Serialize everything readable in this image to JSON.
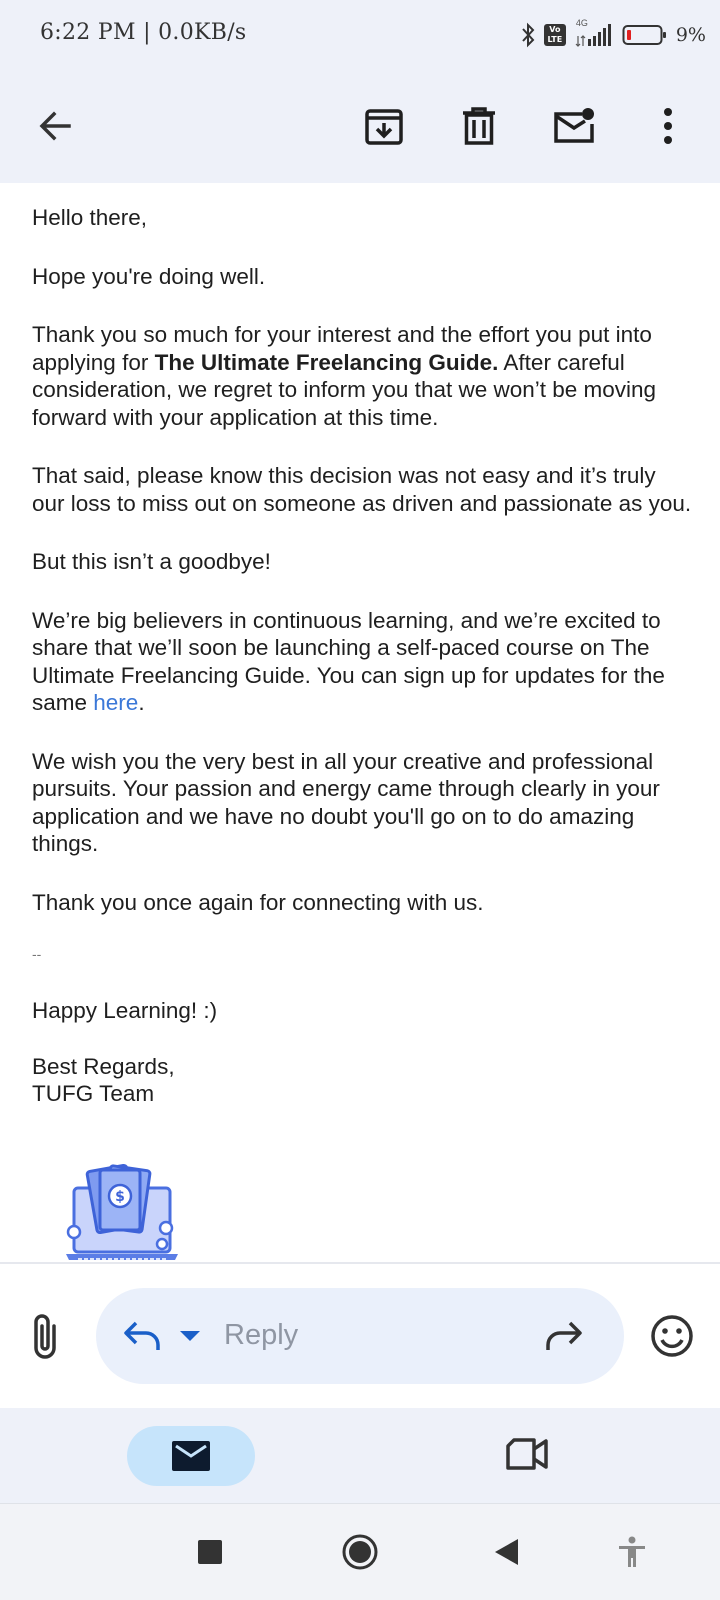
{
  "status_bar": {
    "time_speed": "6:22 PM | 0.0KB/s",
    "network": "4G",
    "lte": "Vo LTE",
    "battery": "9%"
  },
  "app_bar": {
    "icons": [
      "back-arrow-icon",
      "archive-icon",
      "trash-icon",
      "mark-unread-icon",
      "more-vert-icon"
    ]
  },
  "email": {
    "greeting": "Hello there,",
    "p1": "Hope you're doing well.",
    "p2_pre": "Thank you so much for your interest and the effort you put into applying for ",
    "p2_bold": "The Ultimate Freelancing Guide.",
    "p2_post": " After careful consideration, we regret to inform you that we won’t be moving forward with your application at this time.",
    "p3": "That said, please know this decision was not easy and it’s truly our loss to miss out on someone as driven and passionate as you.",
    "p4": "But this isn’t a goodbye!",
    "p5_pre": "We’re big believers in continuous learning, and we’re excited to share that we’ll soon be launching a self-paced course on The Ultimate Freelancing Guide. You can sign up for updates for the same ",
    "p5_link": "here",
    "p5_post": ".",
    "p6": "We wish you the very best in all your creative and professional pursuits. Your passion and energy came through clearly in your application and we have no doubt you'll go on to do amazing things.",
    "p7": "Thank you once again for connecting with us.",
    "sig_separator": "--",
    "sig_line1": "Happy Learning! :)",
    "sig_line2": "Best Regards,",
    "sig_line3": "TUFG Team",
    "logo_icon": "laptop-money-logo"
  },
  "reply_bar": {
    "placeholder": "Reply",
    "icons": [
      "attachment-icon",
      "reply-icon",
      "reply-options-dropdown-icon",
      "forward-icon",
      "emoji-icon"
    ]
  },
  "bottom_nav": {
    "items": [
      "mail-icon",
      "video-meet-icon"
    ],
    "active": "mail-icon",
    "active_color": "#c6e4fb"
  },
  "system_nav": {
    "icons": [
      "recents-square-icon",
      "home-circle-icon",
      "back-triangle-icon",
      "accessibility-icon"
    ]
  },
  "colors": {
    "app_bar_bg": "#eef1f9",
    "link": "#3b78d8",
    "reply_pill": "#eaf0fb"
  }
}
